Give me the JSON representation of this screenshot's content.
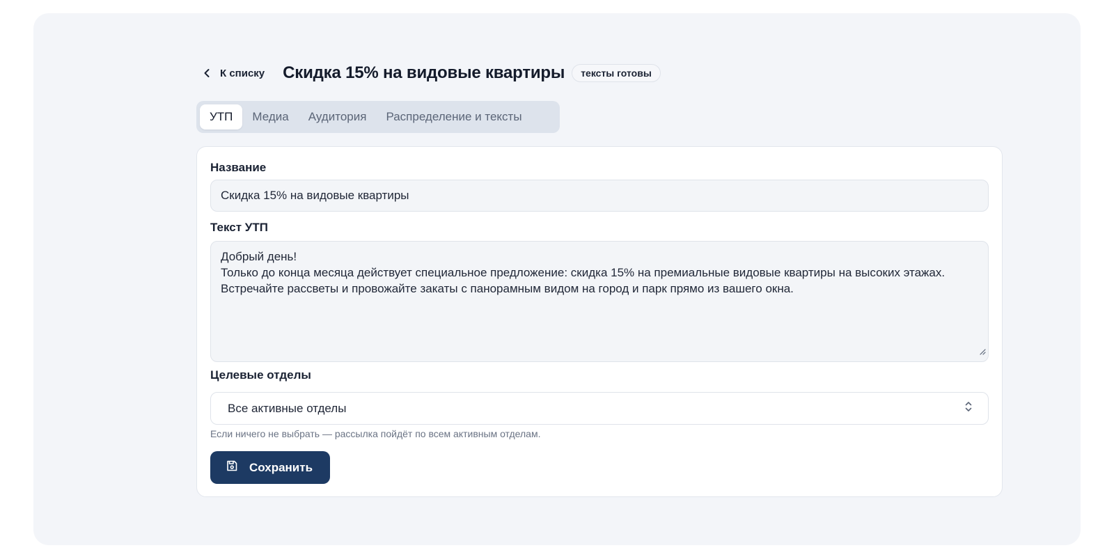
{
  "header": {
    "back_label": "К списку",
    "title": "Скидка 15% на видовые квартиры",
    "status_badge": "тексты готовы"
  },
  "tabs": [
    {
      "label": "УТП",
      "active": true
    },
    {
      "label": "Медиа",
      "active": false
    },
    {
      "label": "Аудитория",
      "active": false
    },
    {
      "label": "Распределение и тексты",
      "active": false
    }
  ],
  "form": {
    "name_label": "Название",
    "name_value": "Скидка 15% на видовые квартиры",
    "utp_label": "Текст УТП",
    "utp_lines": [
      "Добрый день!",
      "Только до конца месяца действует специальное предложение: скидка 15% на премиальные видовые квартиры на высоких этажах. Встречайте рассветы и провожайте закаты с панорамным видом на город и парк прямо из вашего окна."
    ],
    "departments_label": "Целевые отделы",
    "departments_value": "Все активные отделы",
    "departments_hint": "Если ничего не выбрать — рассылка пойдёт по всем активным отделам.",
    "save_label": "Сохранить"
  },
  "icons": {
    "back": "chevron-left-icon",
    "select": "chevron-up-down-icon",
    "save": "floppy-disk-icon"
  },
  "colors": {
    "primary": "#1d3a63",
    "page_bg": "#f3f5f9",
    "tabs_bg": "#dde3ec"
  }
}
